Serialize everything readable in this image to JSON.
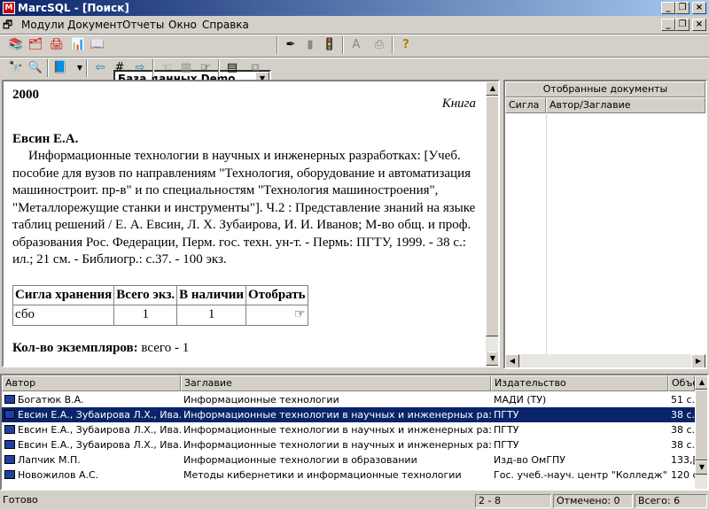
{
  "window": {
    "title": "MarcSQL - [Поиск]",
    "min": "_",
    "max": "❐",
    "close": "×",
    "inner_min": "_",
    "inner_max": "❐",
    "inner_close": "×"
  },
  "menu": {
    "items": [
      "Модули",
      "Документ",
      "Отчеты",
      "Окно",
      "Справка"
    ]
  },
  "toolbar": {
    "database_select": "База данных Demo"
  },
  "document": {
    "year": "2000",
    "kind": "Книга",
    "author": "Евсин Е.А.",
    "text": "Информационные технологии в научных и инженерных разработках: [Учеб. пособие для вузов по направлениям \"Технология, оборудование и автоматизация машиностроит. пр-в\" и по специальностям \"Технология машиностроения\", \"Металлорежущие станки и инструменты\"]. Ч.2 : Представление знаний на языке таблиц решений / Е. А. Евсин, Л. Х. Зубаирова, И. И. Иванов; М-во общ. и проф. образования Рос. Федерации, Перм. гос. техн. ун-т. - Пермь: ПГТУ, 1999. - 38 с.: ил.; 21 см. - Библиогр.: с.37. - 100 экз.",
    "holdings": {
      "headers": [
        "Сигла хранения",
        "Всего экз.",
        "В наличии",
        "Отобрать"
      ],
      "row": {
        "sigla": "сбо",
        "total": "1",
        "available": "1",
        "pick_icon": "pointing-hand-icon"
      }
    },
    "count_label": "Кол-во экземпляров:",
    "count_value": "всего - 1"
  },
  "selected_docs": {
    "title": "Отобранные документы",
    "col_sigla": "Сигла",
    "col_author": "Автор/Заглавие"
  },
  "results": {
    "headers": [
      "Автор",
      "Заглавие",
      "Издательство",
      "Объе"
    ],
    "rows": [
      {
        "author": "Богатюк В.А.",
        "title": "Информационные технологии",
        "publisher": "МАДИ (ТУ)",
        "volume": "51 с."
      },
      {
        "author": "Евсин Е.А., Зубаирова Л.Х., Ива...",
        "title": "Информационные технологии в научных и инженерных разраб...",
        "publisher": "ПГТУ",
        "volume": "38 с."
      },
      {
        "author": "Евсин Е.А., Зубаирова Л.Х., Ива...",
        "title": "Информационные технологии в научных и инженерных разраб...",
        "publisher": "ПГТУ",
        "volume": "38 с."
      },
      {
        "author": "Евсин Е.А., Зубаирова Л.Х., Ива...",
        "title": "Информационные технологии в научных и инженерных разраб...",
        "publisher": "ПГТУ",
        "volume": "38 с."
      },
      {
        "author": "Лапчик М.П.",
        "title": "Информационные технологии в образовании",
        "publisher": "Изд-во ОмГПУ",
        "volume": "133,["
      },
      {
        "author": "Новожилов А.С.",
        "title": "Методы кибернетики и информационные технологии",
        "publisher": "Гос. учеб.-науч. центр \"Колледж\"",
        "volume": "120 с"
      }
    ],
    "selected_row": 1
  },
  "status": {
    "ready": "Готово",
    "position": "2 - 8",
    "marked": "Отмечено: 0",
    "total": "Всего: 6"
  },
  "colors": {
    "selection": "#0a246a",
    "face": "#d4d0c8"
  }
}
